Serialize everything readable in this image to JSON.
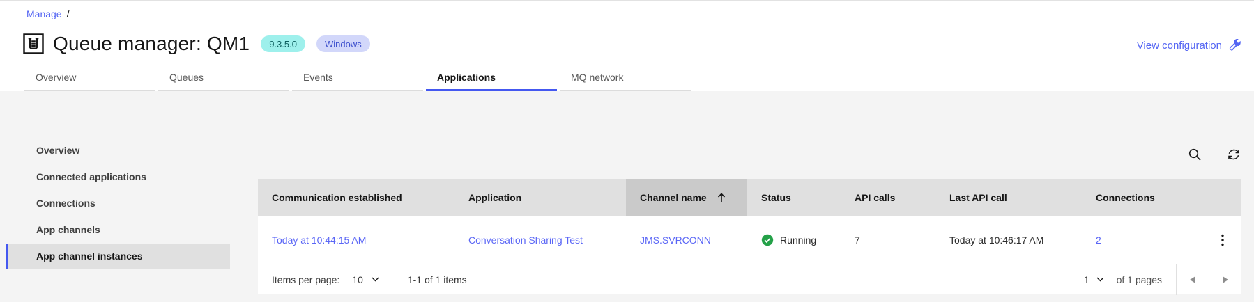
{
  "breadcrumb": {
    "manage": "Manage",
    "separator": "/"
  },
  "header": {
    "title": "Queue manager: QM1",
    "version_badge": "9.3.5.0",
    "platform_badge": "Windows",
    "view_configuration": "View configuration"
  },
  "tabs": {
    "items": [
      "Overview",
      "Queues",
      "Events",
      "Applications",
      "MQ network"
    ],
    "active": "Applications"
  },
  "sidebar": {
    "items": [
      "Overview",
      "Connected applications",
      "Connections",
      "App channels",
      "App channel instances"
    ],
    "active": "App channel instances"
  },
  "table": {
    "columns": [
      "Communication established",
      "Application",
      "Channel name",
      "Status",
      "API calls",
      "Last API call",
      "Connections"
    ],
    "sorted_column": "Channel name",
    "sort_direction": "ascending",
    "rows": [
      {
        "communication_established": "Today at 10:44:15 AM",
        "application": "Conversation Sharing Test",
        "channel_name": "JMS.SVRCONN",
        "status": "Running",
        "api_calls": "7",
        "last_api_call": "Today at 10:46:17 AM",
        "connections": "2"
      }
    ]
  },
  "pagination": {
    "items_per_page_label": "Items per page:",
    "items_per_page_value": "10",
    "range_text": "1-1 of 1 items",
    "page_value": "1",
    "pages_text": "of 1 pages"
  },
  "colors": {
    "accent": "#4458f0",
    "link": "#5a66f6",
    "status_running": "#24a148",
    "version_badge_bg": "#9ef0ec",
    "version_badge_text": "#0b5d5d",
    "platform_badge_bg": "#d2d7fa",
    "platform_badge_text": "#3e50cd",
    "table_header_bg": "#e0e0e0",
    "sorted_header_bg": "#cacaca",
    "content_bg": "#f4f4f4"
  }
}
